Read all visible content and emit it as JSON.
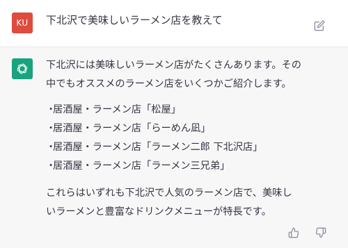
{
  "user": {
    "initials": "KU",
    "message": "下北沢で美味しいラーメン店を教えて"
  },
  "assistant": {
    "intro_line1": "下北沢には美味しいラーメン店がたくさんあります。その",
    "intro_line2": "中でもオススメのラーメン店をいくつかご紹介します。",
    "bullet": "・",
    "items": [
      "居酒屋・ラーメン店「松屋」",
      "居酒屋・ラーメン店「らーめん凪」",
      "居酒屋・ラーメン店「ラーメン二郎 下北沢店」",
      "居酒屋・ラーメン店「ラーメン三兄弟」"
    ],
    "outro_line1": "これらはいずれも下北沢で人気のラーメン店で、美味し",
    "outro_line2": "いラーメンと豊富なドリンクメニューが特長です。"
  },
  "icons": {
    "edit": "edit-icon",
    "assistant_logo": "openai-logo-icon",
    "thumbs_up": "thumbs-up-icon",
    "thumbs_down": "thumbs-down-icon"
  },
  "colors": {
    "user_avatar": "#df4b3c",
    "assistant_avatar": "#19a37f",
    "assistant_bg": "#f7f7f8",
    "text": "#343541"
  }
}
